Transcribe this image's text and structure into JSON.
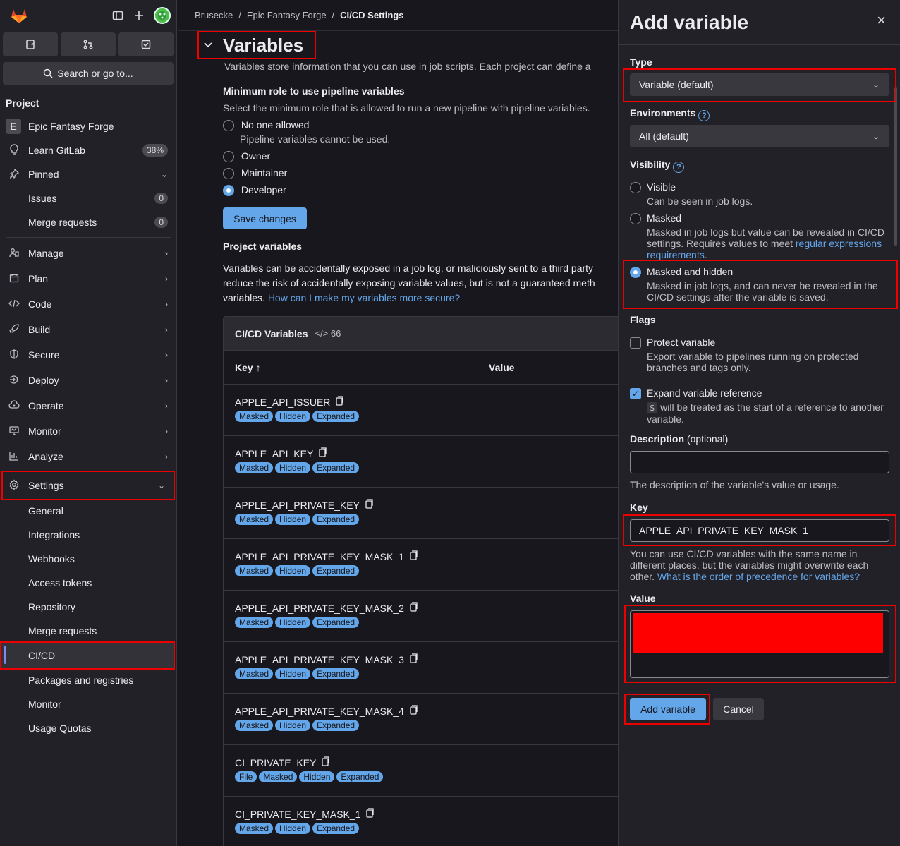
{
  "breadcrumb": {
    "items": [
      "Brusecke",
      "Epic Fantasy Forge"
    ],
    "current": "CI/CD Settings"
  },
  "sidebar": {
    "search": "Search or go to...",
    "section_title": "Project",
    "project_initial": "E",
    "project_name": "Epic Fantasy Forge",
    "learn": {
      "label": "Learn GitLab",
      "badge": "38%"
    },
    "pinned": "Pinned",
    "pinned_items": [
      {
        "label": "Issues",
        "count": "0"
      },
      {
        "label": "Merge requests",
        "count": "0"
      }
    ],
    "nav": [
      "Manage",
      "Plan",
      "Code",
      "Build",
      "Secure",
      "Deploy",
      "Operate",
      "Monitor",
      "Analyze"
    ],
    "settings": "Settings",
    "settings_items": [
      "General",
      "Integrations",
      "Webhooks",
      "Access tokens",
      "Repository",
      "Merge requests",
      "CI/CD",
      "Packages and registries",
      "Monitor",
      "Usage Quotas"
    ]
  },
  "main": {
    "title": "Variables",
    "intro": "Variables store information that you can use in job scripts. Each project can define a",
    "min_role_title": "Minimum role to use pipeline variables",
    "min_role_desc": "Select the minimum role that is allowed to run a new pipeline with pipeline variables.",
    "roles": [
      {
        "label": "No one allowed",
        "desc": "Pipeline variables cannot be used."
      },
      {
        "label": "Owner"
      },
      {
        "label": "Maintainer"
      },
      {
        "label": "Developer"
      }
    ],
    "save": "Save changes",
    "project_vars_title": "Project variables",
    "project_vars_desc1": "Variables can be accidentally exposed in a job log, or maliciously sent to a third party",
    "project_vars_desc2": "reduce the risk of accidentally exposing variable values, but is not a guaranteed meth",
    "project_vars_desc3": "variables.",
    "project_vars_link": "How can I make my variables more secure?",
    "table": {
      "title": "CI/CD Variables",
      "count": "66",
      "col_key": "Key",
      "col_value": "Value",
      "rows": [
        {
          "key": "APPLE_API_ISSUER",
          "tags": [
            "Masked",
            "Hidden",
            "Expanded"
          ]
        },
        {
          "key": "APPLE_API_KEY",
          "tags": [
            "Masked",
            "Hidden",
            "Expanded"
          ]
        },
        {
          "key": "APPLE_API_PRIVATE_KEY",
          "tags": [
            "Masked",
            "Hidden",
            "Expanded"
          ]
        },
        {
          "key": "APPLE_API_PRIVATE_KEY_MASK_1",
          "tags": [
            "Masked",
            "Hidden",
            "Expanded"
          ]
        },
        {
          "key": "APPLE_API_PRIVATE_KEY_MASK_2",
          "tags": [
            "Masked",
            "Hidden",
            "Expanded"
          ]
        },
        {
          "key": "APPLE_API_PRIVATE_KEY_MASK_3",
          "tags": [
            "Masked",
            "Hidden",
            "Expanded"
          ]
        },
        {
          "key": "APPLE_API_PRIVATE_KEY_MASK_4",
          "tags": [
            "Masked",
            "Hidden",
            "Expanded"
          ]
        },
        {
          "key": "CI_PRIVATE_KEY",
          "tags": [
            "File",
            "Masked",
            "Hidden",
            "Expanded"
          ]
        },
        {
          "key": "CI_PRIVATE_KEY_MASK_1",
          "tags": [
            "Masked",
            "Hidden",
            "Expanded"
          ]
        }
      ]
    }
  },
  "drawer": {
    "title": "Add variable",
    "type_label": "Type",
    "type_value": "Variable (default)",
    "env_label": "Environments",
    "env_value": "All (default)",
    "visibility_label": "Visibility",
    "visible": {
      "label": "Visible",
      "desc": "Can be seen in job logs."
    },
    "masked": {
      "label": "Masked",
      "desc": "Masked in job logs but value can be revealed in CI/CD settings. Requires values to meet",
      "link": "regular expressions requirements",
      "end": "."
    },
    "masked_hidden": {
      "label": "Masked and hidden",
      "desc": "Masked in job logs, and can never be revealed in the CI/CD settings after the variable is saved."
    },
    "flags_label": "Flags",
    "protect": {
      "label": "Protect variable",
      "desc": "Export variable to pipelines running on protected branches and tags only."
    },
    "expand": {
      "label": "Expand variable reference",
      "dollar": "$",
      "desc": "will be treated as the start of a reference to another variable."
    },
    "desc_label": "Description",
    "desc_optional": "(optional)",
    "desc_help": "The description of the variable's value or usage.",
    "key_label": "Key",
    "key_value": "APPLE_API_PRIVATE_KEY_MASK_1",
    "key_help": "You can use CI/CD variables with the same name in different places, but the variables might overwrite each other.",
    "key_help_link": "What is the order of precedence for variables?",
    "value_label": "Value",
    "add_button": "Add variable",
    "cancel_button": "Cancel"
  }
}
